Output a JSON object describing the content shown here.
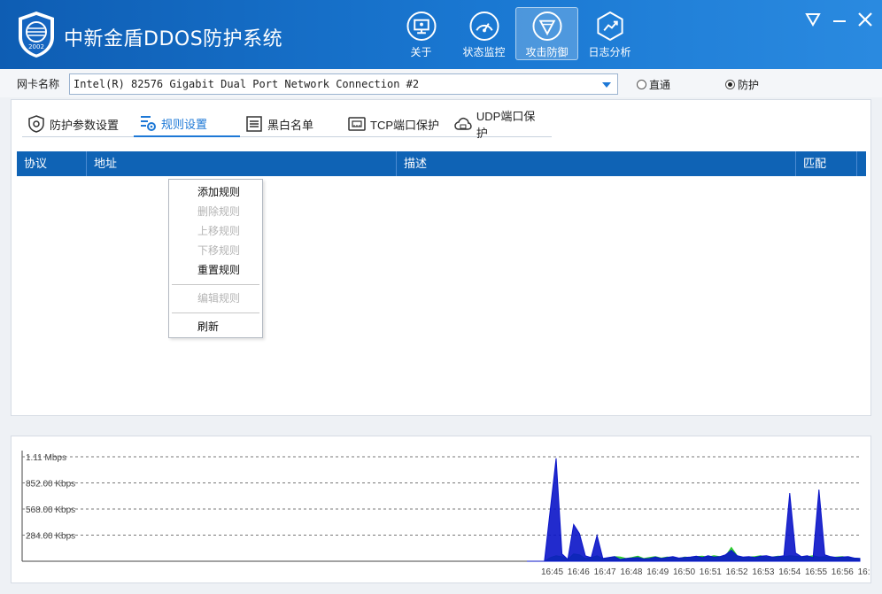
{
  "app": {
    "title": "中新金盾DDOS防护系统",
    "logo_text": "2002"
  },
  "nav": [
    {
      "label": "关于",
      "icon": "monitor-icon",
      "active": false
    },
    {
      "label": "状态监控",
      "icon": "gauge-icon",
      "active": false
    },
    {
      "label": "攻击防御",
      "icon": "shield-icon",
      "active": true
    },
    {
      "label": "日志分析",
      "icon": "chart-icon",
      "active": false
    }
  ],
  "nic": {
    "label": "网卡名称",
    "value": "Intel(R) 82576 Gigabit Dual Port Network Connection #2",
    "modes": [
      {
        "label": "直通",
        "checked": false
      },
      {
        "label": "防护",
        "checked": true
      }
    ]
  },
  "tabs": [
    {
      "label": "防护参数设置",
      "icon": "shield-gear-icon",
      "active": false
    },
    {
      "label": "规则设置",
      "icon": "rules-icon",
      "active": true
    },
    {
      "label": "黑白名单",
      "icon": "list-icon",
      "active": false
    },
    {
      "label": "TCP端口保护",
      "icon": "port-icon",
      "active": false
    },
    {
      "label": "UDP端口保护",
      "icon": "cloud-icon",
      "active": false
    }
  ],
  "table": {
    "columns": [
      "协议",
      "地址",
      "描述",
      "匹配"
    ]
  },
  "context_menu": [
    {
      "label": "添加规则",
      "enabled": true
    },
    {
      "label": "删除规则",
      "enabled": false
    },
    {
      "label": "上移规则",
      "enabled": false
    },
    {
      "label": "下移规则",
      "enabled": false
    },
    {
      "label": "重置规则",
      "enabled": true
    },
    {
      "separator": true
    },
    {
      "label": "编辑规则",
      "enabled": false
    },
    {
      "separator": true
    },
    {
      "label": "刷新",
      "enabled": true
    }
  ],
  "colors": {
    "header_bg": "#1a78d2",
    "table_header": "#0f63b5",
    "accent": "#1d78d6",
    "series_blue": "#0a14c8",
    "series_green": "#22cc22"
  },
  "chart_data": {
    "type": "area",
    "y_ticks": [
      "1.11 Mbps",
      "852.00 Kbps",
      "568.00 Kbps",
      "284.00 Kbps"
    ],
    "y_tick_values": [
      1136,
      852,
      568,
      284
    ],
    "ylim": [
      0,
      1136
    ],
    "x_ticks": [
      "16:45",
      "16:46",
      "16:47",
      "16:48",
      "16:49",
      "16:50",
      "16:51",
      "16:52",
      "16:53",
      "16:54",
      "16:55",
      "16:56",
      "16:"
    ],
    "grid": true,
    "series": [
      {
        "values": [
          0,
          0,
          0,
          0,
          560,
          1120,
          80,
          20,
          400,
          300,
          60,
          40,
          280,
          30,
          40,
          50,
          20,
          30,
          35,
          40,
          25,
          30,
          45,
          30,
          40,
          50,
          35,
          40,
          45,
          55,
          40,
          60,
          45,
          50,
          70,
          120,
          60,
          45,
          50,
          40,
          55,
          60,
          45,
          50,
          60,
          740,
          90,
          50,
          60,
          40,
          780,
          70,
          50,
          40,
          45,
          50,
          35,
          30
        ]
      },
      {
        "values": [
          0,
          0,
          0,
          0,
          40,
          60,
          50,
          20,
          80,
          70,
          30,
          40,
          60,
          30,
          35,
          50,
          45,
          30,
          40,
          55,
          30,
          40,
          50,
          35,
          45,
          40,
          30,
          45,
          40,
          50,
          55,
          45,
          60,
          50,
          55,
          150,
          60,
          40,
          45,
          50,
          60,
          40,
          45,
          55,
          50,
          60,
          55,
          45,
          50,
          60,
          45,
          50,
          40,
          45,
          50,
          40,
          35,
          30
        ]
      }
    ]
  }
}
